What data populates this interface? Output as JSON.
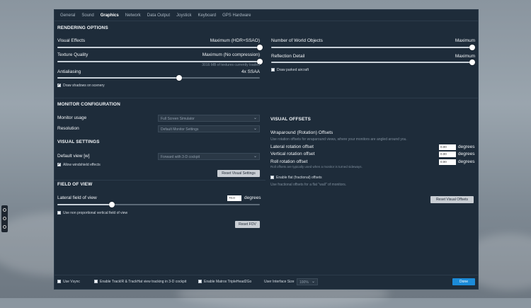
{
  "tabs": [
    "General",
    "Sound",
    "Graphics",
    "Network",
    "Data Output",
    "Joystick",
    "Keyboard",
    "GPS Hardware"
  ],
  "active_tab": 2,
  "rendering": {
    "header": "RENDERING OPTIONS",
    "visual_effects": {
      "label": "Visual Effects",
      "value": "Maximum (HDR+SSAO)",
      "level": 1.0
    },
    "texture_quality": {
      "label": "Texture Quality",
      "value": "Maximum (No compression)",
      "level": 1.0,
      "note": "3016 MB of textures currently loaded"
    },
    "antialiasing": {
      "label": "Antialiasing",
      "value": "4x SSAA",
      "level": 0.6
    },
    "draw_shadows": {
      "label": "Draw shadows on scenery",
      "checked": true
    },
    "world_objects": {
      "label": "Number of World Objects",
      "value": "Maximum",
      "level": 1.0
    },
    "reflection_detail": {
      "label": "Reflection Detail",
      "value": "Maximum",
      "level": 1.0
    },
    "draw_parked": {
      "label": "Draw parked aircraft",
      "checked": false
    }
  },
  "monitor": {
    "header": "MONITOR CONFIGURATION",
    "usage_label": "Monitor usage",
    "usage_value": "Full Screen Simulator",
    "resolution_label": "Resolution",
    "resolution_value": "Default Monitor Settings"
  },
  "visual_settings": {
    "header": "VISUAL SETTINGS",
    "default_view_label": "Default view [w]",
    "default_view_value": "Forward with 3-D cockpit",
    "allow_windshield": {
      "label": "Allow windshield effects",
      "checked": true
    },
    "reset_label": "Reset Visual Settings"
  },
  "fov": {
    "header": "FIELD OF VIEW",
    "lateral_label": "Lateral field of view",
    "lateral_value": "70.0",
    "units": "degrees",
    "level": 0.27,
    "non_proportional": {
      "label": "Use non proportional vertical field of view",
      "checked": false
    },
    "reset_label": "Reset FOV"
  },
  "visual_offsets": {
    "header": "VISUAL OFFSETS",
    "wrap_title": "Wraparound (Rotation) Offsets",
    "wrap_desc": "Use rotation offsets for wraparound views, where your monitors are angled around you.",
    "lateral_label": "Lateral rotation offset",
    "lateral_value": "0.00",
    "vertical_label": "Vertical rotation offset",
    "vertical_value": "0.00",
    "roll_label": "Roll rotation offset",
    "roll_value": "0.00",
    "roll_note": "Roll offsets are typically used when a monitor is turned sideways.",
    "units": "degrees",
    "flat": {
      "label": "Enable flat (fractional) offsets",
      "checked": false
    },
    "flat_desc": "Use fractional offsets for a flat \"wall\" of monitors.",
    "reset_label": "Reset Visual Offsets"
  },
  "footer": {
    "vsync": {
      "label": "Use Vsync",
      "checked": false
    },
    "trackir": {
      "label": "Enable TrackIR & TrackHat view tracking in 3-D cockpit",
      "checked": false
    },
    "matrox": {
      "label": "Enable Matrox TripleHead2Go",
      "checked": false
    },
    "ui_size_label": "User Interface Size",
    "ui_size_value": "100%",
    "done_label": "Done"
  }
}
